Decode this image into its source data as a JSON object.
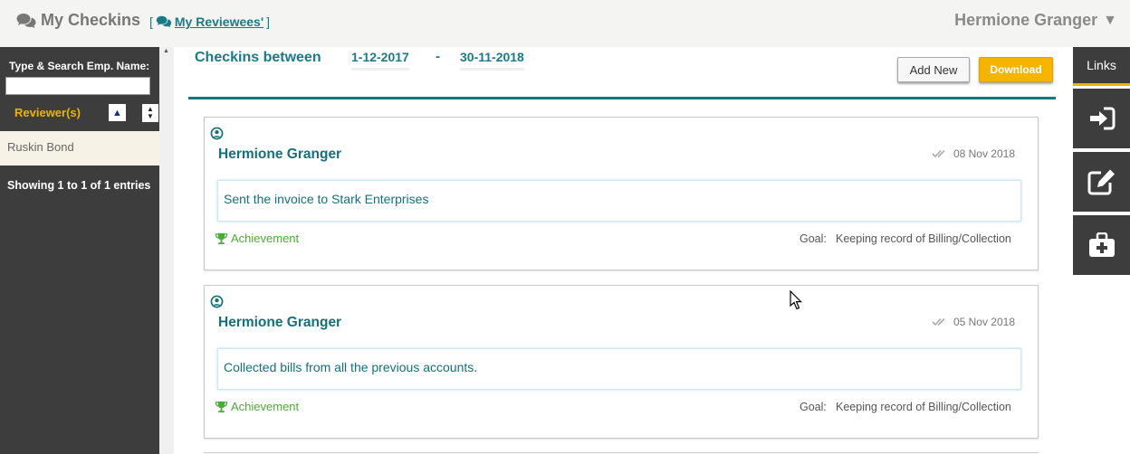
{
  "header": {
    "title": "My Checkins",
    "reviewees_prefix": "[",
    "reviewees_link": "My Reviewees'",
    "reviewees_suffix": "]",
    "user_name": "Hermione Granger",
    "user_caret": "▼"
  },
  "sidebar": {
    "search_label": "Type & Search Emp. Name:",
    "search_value": "",
    "reviewers_label": "Reviewer(s)",
    "reviewers": [
      "Ruskin Bond"
    ],
    "entries_text": "Showing 1 to 1 of 1 entries"
  },
  "main": {
    "range_label": "Checkins between",
    "date_from": "1-12-2017",
    "date_separator": "-",
    "date_to": "30-11-2018",
    "add_new_label": "Add New",
    "download_label": "Download",
    "checkins": [
      {
        "name": "Hermione Granger",
        "date": "08 Nov 2018",
        "message": "Sent the invoice to Stark Enterprises",
        "type": "Achievement",
        "goal_label": "Goal:",
        "goal": "Keeping record of Billing/Collection"
      },
      {
        "name": "Hermione Granger",
        "date": "05 Nov 2018",
        "message": "Collected bills from all the previous accounts.",
        "type": "Achievement",
        "goal_label": "Goal:",
        "goal": "Keeping record of Billing/Collection"
      }
    ]
  },
  "rightbar": {
    "links_label": "Links",
    "icons": [
      "sign-in-icon",
      "edit-icon",
      "medical-kit-icon"
    ]
  },
  "colors": {
    "accent_teal": "#15707a",
    "accent_gold": "#f0b200",
    "sidebar_dark": "#3d3d3d",
    "achievement_green": "#4caa3a"
  }
}
